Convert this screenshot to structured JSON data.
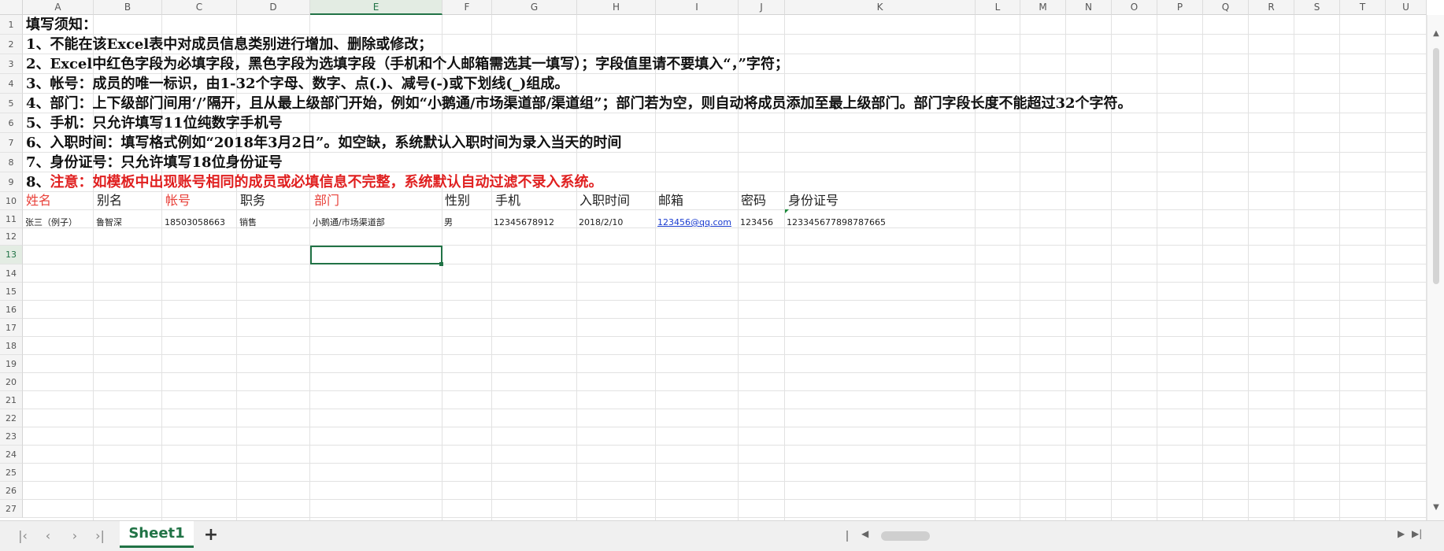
{
  "columns": [
    "A",
    "B",
    "C",
    "D",
    "E",
    "F",
    "G",
    "H",
    "I",
    "J",
    "K",
    "L",
    "M",
    "N",
    "O",
    "P",
    "Q",
    "R",
    "S",
    "T",
    "U"
  ],
  "selected_column": "E",
  "rows": [
    "1",
    "2",
    "3",
    "4",
    "5",
    "6",
    "7",
    "8",
    "9",
    "10",
    "11",
    "12",
    "13",
    "14",
    "15",
    "16",
    "17",
    "18",
    "19",
    "20",
    "21",
    "22",
    "23",
    "24",
    "25",
    "26",
    "27"
  ],
  "selected_row": "13",
  "notes": {
    "line1": "填写须知：",
    "line2": "1、不能在该Excel表中对成员信息类别进行增加、删除或修改；",
    "line3": "2、Excel中红色字段为必填字段，黑色字段为选填字段（手机和个人邮箱需选其一填写）；字段值里请不要填入“，”字符；",
    "line4": "3、帐号：成员的唯一标识，由1-32个字母、数字、点(.)、减号(-)或下划线(_)组成。",
    "line5": "4、部门：上下级部门间用‘/’隔开，且从最上级部门开始，例如“小鹅通/市场渠道部/渠道组”；部门若为空，则自动将成员添加至最上级部门。部门字段长度不能超过32个字符。",
    "line6": "5、手机：只允许填写11位纯数字手机号",
    "line7": "6、入职时间：填写格式例如“2018年3月2日”。如空缺，系统默认入职时间为录入当天的时间",
    "line8": "7、身份证号：只允许填写18位身份证号",
    "line9_prefix": "8、",
    "line9_red": "注意：如模板中出现账号相同的成员或必填信息不完整，系统默认自动过滤不录入系统。"
  },
  "headers": {
    "name": "姓名",
    "alias": "别名",
    "account": "帐号",
    "position": "职务",
    "department": "部门",
    "gender": "性别",
    "mobile": "手机",
    "hire_date": "入职时间",
    "email": "邮箱",
    "password": "密码",
    "id_number": "身份证号"
  },
  "example_row": {
    "name": "张三（例子）",
    "alias": "鲁智深",
    "account": "18503058663",
    "position": "销售",
    "department": "小鹅通/市场渠道部",
    "gender": "男",
    "mobile": "12345678912",
    "hire_date": "2018/2/10",
    "email": "123456@qq.com",
    "password": "123456",
    "id_number": "123345677898787665"
  },
  "sheet_tabs": [
    "Sheet1"
  ],
  "colors": {
    "accent": "#217346",
    "required_field": "#e8413a",
    "warning_text": "#e02020",
    "link": "#1a3ccf"
  },
  "icons": {
    "first_sheet": "first-page-icon",
    "prev_sheet": "chevron-left-icon",
    "next_sheet": "chevron-right-icon",
    "last_sheet": "last-page-icon",
    "add_sheet": "plus-icon"
  }
}
